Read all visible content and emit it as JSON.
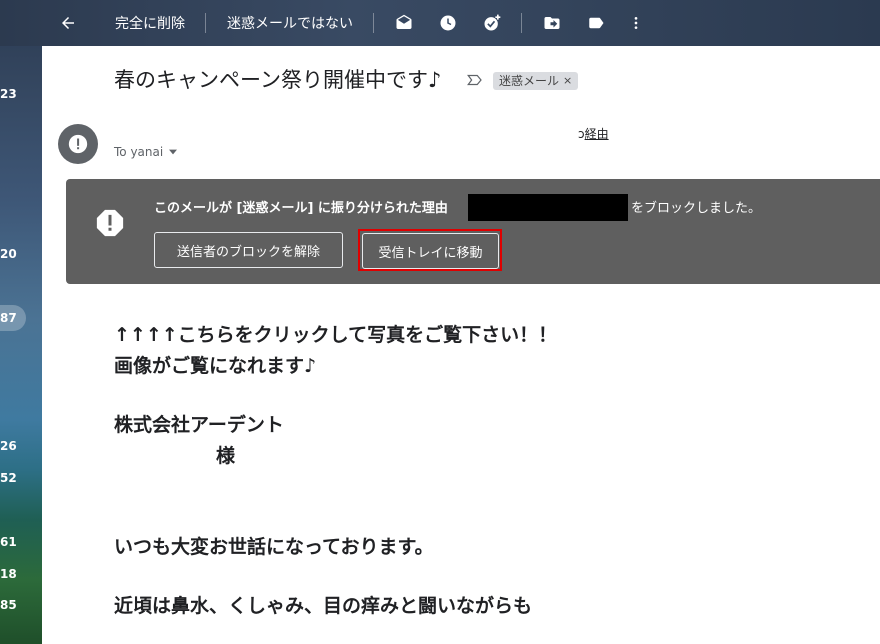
{
  "toolbar": {
    "delete_forever": "完全に削除",
    "not_spam": "迷惑メールではない"
  },
  "left_counts": [
    "23",
    "20",
    "87",
    "26",
    "52",
    "61",
    "18",
    "85"
  ],
  "email": {
    "subject": "春のキャンペーン祭り開催中です♪",
    "label": "迷惑メール",
    "label_close": "×",
    "via_link": "経由",
    "via_prefix": "ɔ",
    "to": "To yanai",
    "banner": {
      "reason_text": "このメールが [迷惑メール] に振り分けられた理由",
      "blocked_text": "をブロックしました。",
      "unblock_button": "送信者のブロックを解除",
      "move_button": "受信トレイに移動"
    },
    "body_lines": [
      "↑↑↑↑こちらをクリックして写真をご覧下さい！！",
      "画像がご覧になれます♪",
      "株式会社アーデント",
      "様",
      "いつも大変お世話になっております。",
      "近頃は鼻水、くしゃみ、目の痒みと闘いながらも"
    ]
  },
  "colors": {
    "banner_bg": "#5f5f5f",
    "highlight": "#e00000",
    "avatar": "#5f6368"
  }
}
